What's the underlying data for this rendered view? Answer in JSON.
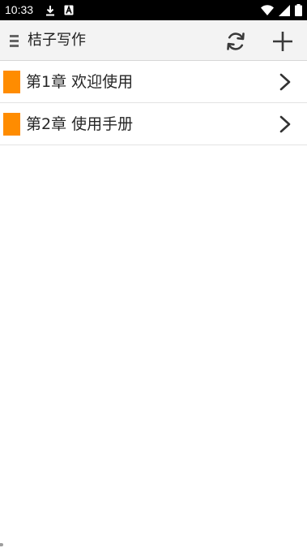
{
  "status_bar": {
    "time": "10:33",
    "left_icons": [
      "download-icon",
      "keyboard-a-icon"
    ],
    "right_icons": [
      "wifi-icon",
      "signal-icon",
      "battery-icon"
    ]
  },
  "app_bar": {
    "title": "桔子写作",
    "background": "#f3f3f3",
    "icons": [
      "drag-handle-icon",
      "refresh-icon",
      "add-icon"
    ]
  },
  "chapters": [
    {
      "title": "第1章 欢迎使用"
    },
    {
      "title": "第2章 使用手册"
    }
  ],
  "colors": {
    "chapter_marker": "#ff8c00",
    "status_bar": "#000000",
    "divider": "#e3e3e3"
  }
}
